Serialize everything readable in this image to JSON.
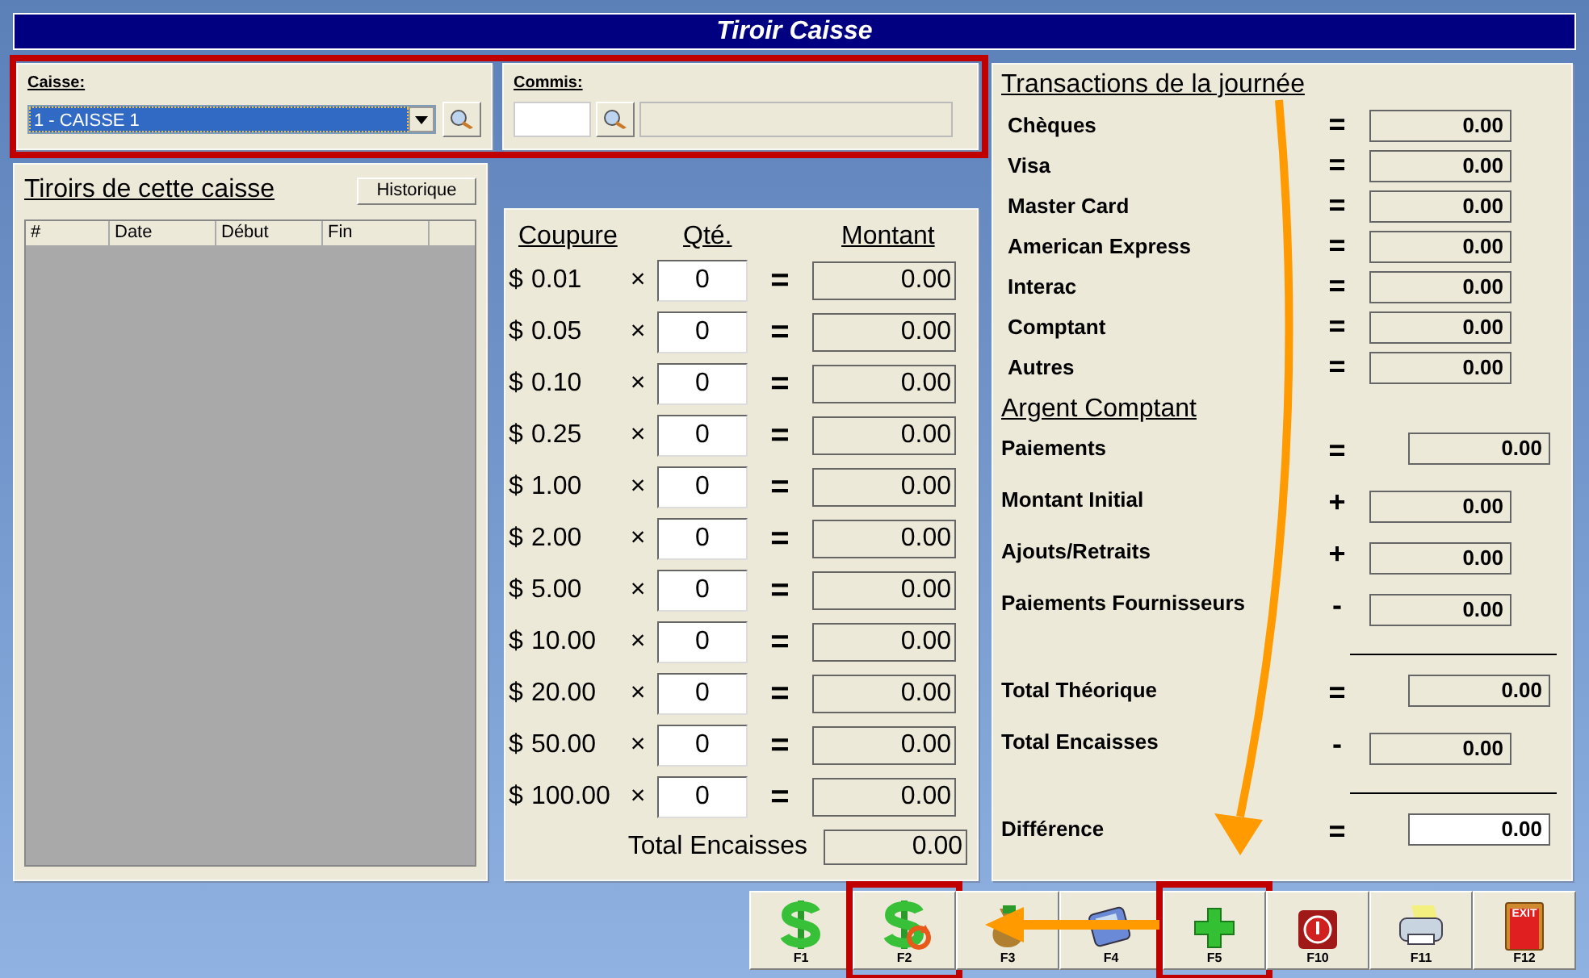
{
  "title": "Tiroir Caisse",
  "header_panels": {
    "highlighted": true,
    "caisse": {
      "label": "Caisse:",
      "value": "1 - CAISSE 1"
    },
    "commis": {
      "label": "Commis:"
    }
  },
  "tiroirs": {
    "title": "Tiroirs de cette caisse",
    "history_button": "Historique",
    "columns": [
      "#",
      "Date",
      "Début",
      "Fin"
    ]
  },
  "denominations": {
    "headers": [
      "Coupure",
      "Qté.",
      "Montant"
    ],
    "rows": [
      {
        "currency": "$",
        "value": "0.01",
        "times": "×",
        "qty": "0",
        "equals": "=",
        "amount": "0.00"
      },
      {
        "currency": "$",
        "value": "0.05",
        "times": "×",
        "qty": "0",
        "equals": "=",
        "amount": "0.00"
      },
      {
        "currency": "$",
        "value": "0.10",
        "times": "×",
        "qty": "0",
        "equals": "=",
        "amount": "0.00"
      },
      {
        "currency": "$",
        "value": "0.25",
        "times": "×",
        "qty": "0",
        "equals": "=",
        "amount": "0.00"
      },
      {
        "currency": "$",
        "value": "1.00",
        "times": "×",
        "qty": "0",
        "equals": "=",
        "amount": "0.00"
      },
      {
        "currency": "$",
        "value": "2.00",
        "times": "×",
        "qty": "0",
        "equals": "=",
        "amount": "0.00"
      },
      {
        "currency": "$",
        "value": "5.00",
        "times": "×",
        "qty": "0",
        "equals": "=",
        "amount": "0.00"
      },
      {
        "currency": "$",
        "value": "10.00",
        "times": "×",
        "qty": "0",
        "equals": "=",
        "amount": "0.00"
      },
      {
        "currency": "$",
        "value": "20.00",
        "times": "×",
        "qty": "0",
        "equals": "=",
        "amount": "0.00"
      },
      {
        "currency": "$",
        "value": "50.00",
        "times": "×",
        "qty": "0",
        "equals": "=",
        "amount": "0.00"
      },
      {
        "currency": "$",
        "value": "100.00",
        "times": "×",
        "qty": "0",
        "equals": "=",
        "amount": "0.00"
      }
    ],
    "total_label": "Total Encaisses",
    "total": "0.00"
  },
  "transactions": {
    "title": "Transactions de la journée",
    "rows": [
      {
        "label": "Chèques",
        "operator": "=",
        "amount": "0.00"
      },
      {
        "label": "Visa",
        "operator": "=",
        "amount": "0.00"
      },
      {
        "label": "Master Card",
        "operator": "=",
        "amount": "0.00"
      },
      {
        "label": "American Express",
        "operator": "=",
        "amount": "0.00"
      },
      {
        "label": "Interac",
        "operator": "=",
        "amount": "0.00"
      },
      {
        "label": "Comptant",
        "operator": "=",
        "amount": "0.00"
      },
      {
        "label": "Autres",
        "operator": "=",
        "amount": "0.00"
      }
    ]
  },
  "cash": {
    "title": "Argent Comptant",
    "rows": [
      {
        "kind": "subtotal",
        "label": "Paiements",
        "operator": "=",
        "amount": "0.00"
      },
      {
        "kind": "entry",
        "label": "Montant Initial",
        "operator": "+",
        "amount": "0.00"
      },
      {
        "kind": "entry",
        "label": "Ajouts/Retraits",
        "operator": "+",
        "amount": "0.00"
      },
      {
        "kind": "entry",
        "label": "Paiements Fournisseurs",
        "operator": "-",
        "amount": "0.00"
      },
      {
        "kind": "rule"
      },
      {
        "kind": "subtotal",
        "label": "Total Théorique",
        "operator": "=",
        "amount": "0.00"
      },
      {
        "kind": "entry",
        "label": "Total Encaisses",
        "operator": "-",
        "amount": "0.00"
      },
      {
        "kind": "rule"
      },
      {
        "kind": "result",
        "label": "Différence",
        "operator": "=",
        "amount": "0.00"
      }
    ]
  },
  "toolbar": [
    {
      "key": "F1",
      "kind": "dollar",
      "highlighted": false
    },
    {
      "key": "F2",
      "kind": "refund",
      "highlighted": true
    },
    {
      "key": "F3",
      "kind": "bag",
      "highlighted": false
    },
    {
      "key": "F4",
      "kind": "calculator",
      "highlighted": false
    },
    {
      "key": "F5",
      "kind": "plus",
      "highlighted": true
    },
    {
      "key": "F10",
      "kind": "power",
      "highlighted": false
    },
    {
      "key": "F11",
      "kind": "printer",
      "highlighted": false
    },
    {
      "key": "F12",
      "kind": "exit",
      "highlighted": false,
      "sign": "EXIT"
    }
  ],
  "annotations": {
    "curved_arrow": true,
    "left_arrow": true
  }
}
